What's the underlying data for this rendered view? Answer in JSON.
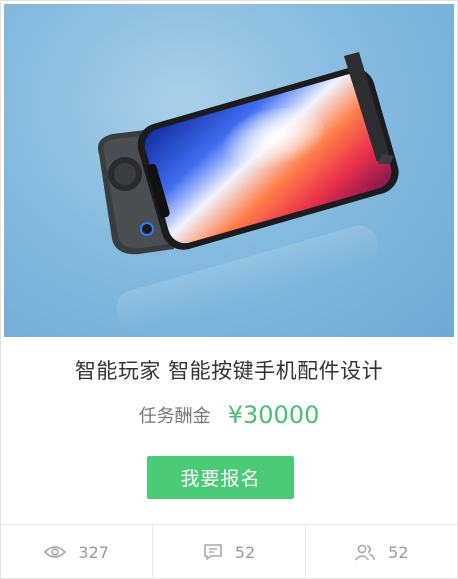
{
  "product": {
    "title": "智能玩家 智能按键手机配件设计",
    "reward_label": "任务酬金",
    "reward_amount": "¥30000",
    "cta_label": "我要报名"
  },
  "stats": [
    {
      "icon": "eye-icon",
      "value": "327"
    },
    {
      "icon": "comment-icon",
      "value": "52"
    },
    {
      "icon": "users-icon",
      "value": "52"
    }
  ],
  "colors": {
    "accent": "#4ccb76",
    "reward": "#48c072",
    "hero_background": "#86bbdf"
  }
}
